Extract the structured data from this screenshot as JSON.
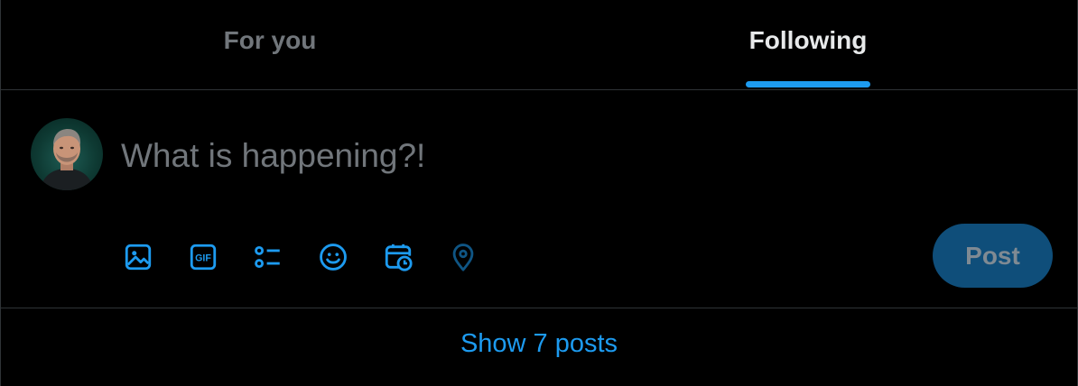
{
  "tabs": [
    {
      "label": "For you",
      "active": false
    },
    {
      "label": "Following",
      "active": true
    }
  ],
  "composer": {
    "placeholder": "What is happening?!",
    "value": "",
    "post_label": "Post",
    "toolbar": [
      {
        "icon": "image-icon",
        "label": "Media"
      },
      {
        "icon": "gif-icon",
        "label": "GIF",
        "text": "GIF"
      },
      {
        "icon": "poll-icon",
        "label": "Poll"
      },
      {
        "icon": "emoji-icon",
        "label": "Emoji"
      },
      {
        "icon": "schedule-icon",
        "label": "Schedule"
      },
      {
        "icon": "location-icon",
        "label": "Location"
      }
    ]
  },
  "timeline": {
    "show_posts_label": "Show 7 posts"
  },
  "colors": {
    "accent": "#1d9bf0",
    "background": "#000000",
    "border": "#2f3336",
    "muted_text": "#71767b",
    "post_button_disabled": "#0f4e7a"
  }
}
